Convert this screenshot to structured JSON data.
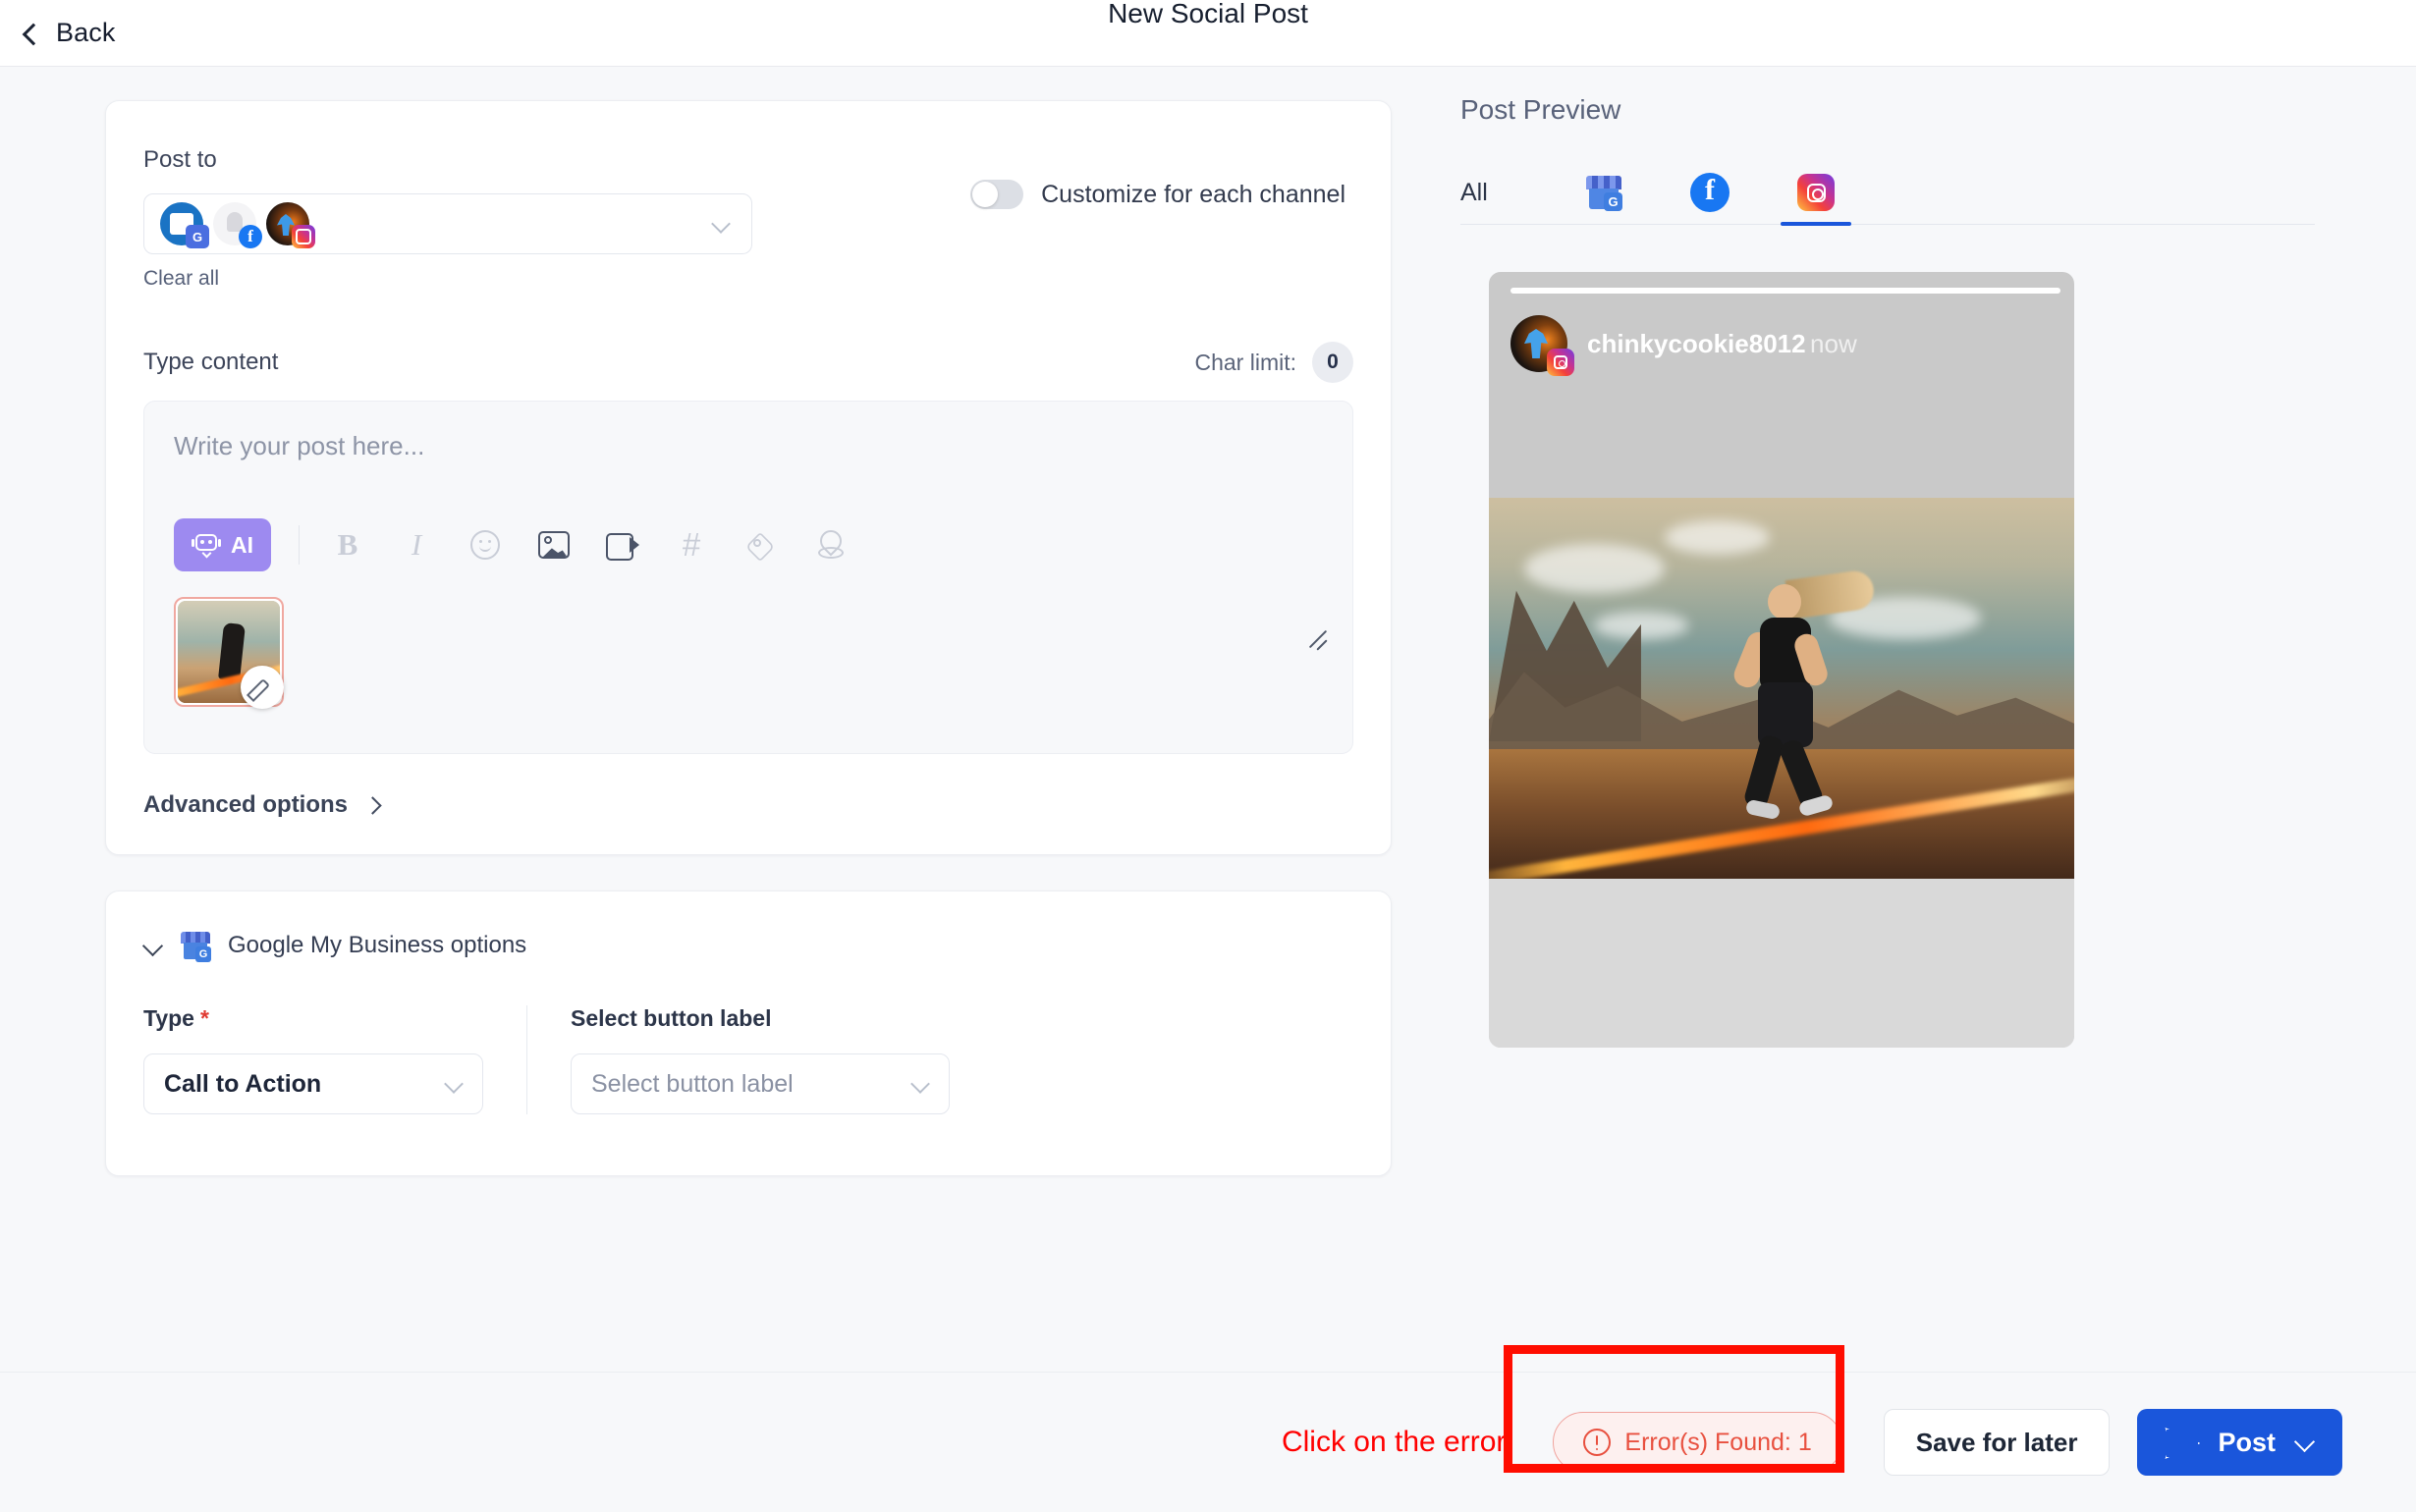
{
  "topbar": {
    "back_label": "Back",
    "title": "New Social Post",
    "back_icon": "chevron-left-icon"
  },
  "compose": {
    "post_to_label": "Post to",
    "clear_all_label": "Clear all",
    "channels": [
      {
        "name": "Google My Business account",
        "badge": "google-my-business-icon"
      },
      {
        "name": "Facebook page",
        "badge": "facebook-icon"
      },
      {
        "name": "Instagram account",
        "badge": "instagram-icon"
      }
    ],
    "customize_toggle_label": "Customize for each channel",
    "customize_toggle_state": "off",
    "type_content_label": "Type content",
    "char_limit_label": "Char limit:",
    "char_limit_value": "0",
    "editor_placeholder": "Write your post here...",
    "editor_value": "",
    "toolbar": {
      "ai_label": "AI",
      "icons": [
        "bold-icon",
        "italic-icon",
        "emoji-icon",
        "image-icon",
        "video-icon",
        "hashtag-icon",
        "tag-icon",
        "location-icon"
      ]
    },
    "attachment": {
      "name": "runner-thumbnail",
      "edit_icon": "pencil-icon",
      "has_error": true
    },
    "advanced_options_label": "Advanced options"
  },
  "gmb": {
    "section_title": "Google My Business options",
    "section_icon": "google-my-business-icon",
    "collapse_icon": "chevron-down-icon",
    "type_label": "Type",
    "type_required": "*",
    "type_value": "Call to Action",
    "button_label_label": "Select button label",
    "button_label_placeholder": "Select button label"
  },
  "preview": {
    "title": "Post Preview",
    "tabs": [
      {
        "label": "All",
        "icon": "",
        "active": false
      },
      {
        "label": "",
        "icon": "google-my-business-icon",
        "active": false
      },
      {
        "label": "",
        "icon": "facebook-icon",
        "active": false
      },
      {
        "label": "",
        "icon": "instagram-icon",
        "active": true
      }
    ],
    "card": {
      "username": "chinkycookie8012",
      "timestamp": "now",
      "platform_badge": "instagram-icon",
      "caption": ""
    }
  },
  "bottombar": {
    "hint_text": "Click on the error",
    "error_label": "Error(s) Found: 1",
    "error_icon": "alert-circle-icon",
    "save_label": "Save for later",
    "post_label": "Post",
    "post_icon": "send-icon",
    "post_chevron": "chevron-down-icon"
  },
  "colors": {
    "accent_blue": "#1a56db",
    "error_red": "#e8503f",
    "annotation_red": "#ff0000",
    "ai_purple": "#9d8af0"
  }
}
